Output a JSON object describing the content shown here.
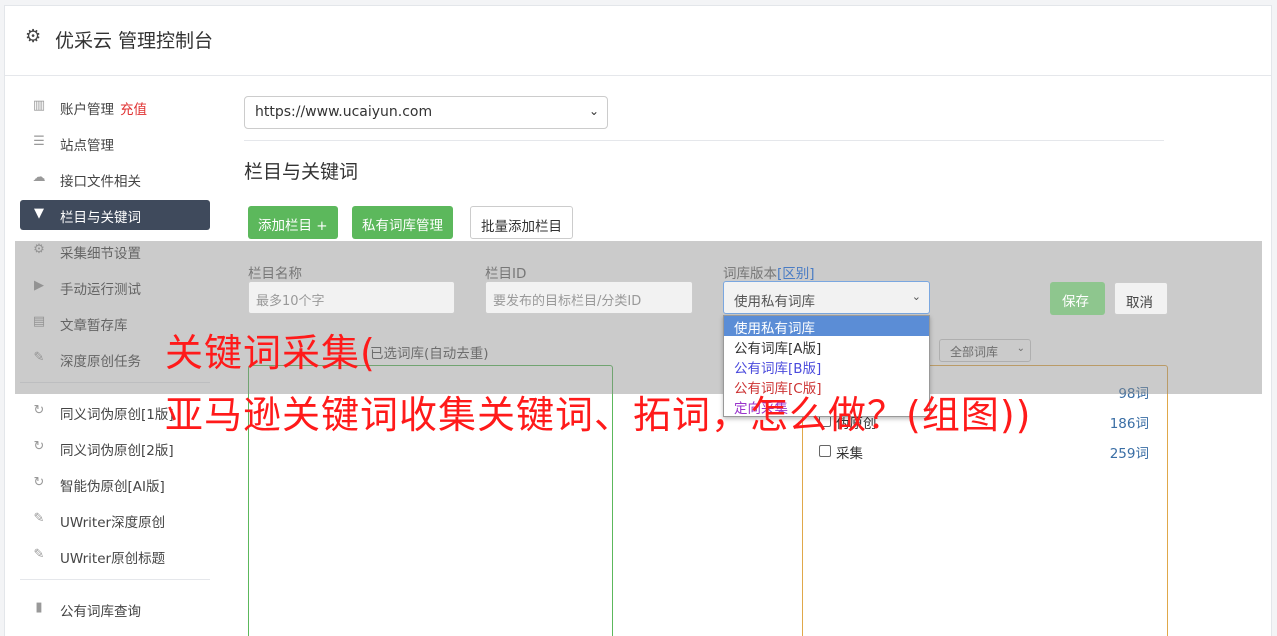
{
  "header": {
    "title": "优采云 管理控制台",
    "icon": "gear-icon"
  },
  "sidebar": {
    "items": [
      {
        "label": "账户管理",
        "icon": "bar-chart-icon",
        "extra": "充值"
      },
      {
        "label": "站点管理",
        "icon": "server-icon"
      },
      {
        "label": "接口文件相关",
        "icon": "cloud-upload-icon"
      },
      {
        "label": "栏目与关键词",
        "icon": "filter-icon",
        "active": true
      },
      {
        "label": "采集细节设置",
        "icon": "gears-icon"
      },
      {
        "label": "手动运行测试",
        "icon": "play-circle-icon"
      },
      {
        "label": "文章暂存库",
        "icon": "database-icon"
      },
      {
        "label": "深度原创任务",
        "icon": "edit-icon"
      }
    ],
    "items2": [
      {
        "label": "同义词伪原创[1版]",
        "icon": "refresh-icon"
      },
      {
        "label": "同义词伪原创[2版]",
        "icon": "refresh-icon"
      },
      {
        "label": "智能伪原创[AI版]",
        "icon": "refresh-icon"
      },
      {
        "label": "UWriter深度原创",
        "icon": "edit-icon"
      },
      {
        "label": "UWriter原创标题",
        "icon": "edit-icon"
      }
    ],
    "items3": [
      {
        "label": "公有词库查询",
        "icon": "book-icon"
      }
    ]
  },
  "site_select": {
    "value": "https://www.ucaiyun.com"
  },
  "section": {
    "title": "栏目与关键词"
  },
  "buttons": {
    "add_column": "添加栏目 +",
    "private_lib": "私有词库管理",
    "batch_add": "批量添加栏目"
  },
  "form": {
    "name_label": "栏目名称",
    "name_placeholder": "最多10个字",
    "id_label": "栏目ID",
    "id_placeholder": "要发布的目标栏目/分类ID",
    "version_label": "词库版本",
    "version_link": "[区别]",
    "version_value": "使用私有词库",
    "save": "保存",
    "cancel": "取消"
  },
  "dropdown": {
    "options": [
      "使用私有词库",
      "公有词库[A版]",
      "公有词库[B版]",
      "公有词库[C版]",
      "定向采集"
    ]
  },
  "selected_lib": {
    "label": "已选词库(自动去重)"
  },
  "lib_filter": {
    "value": "全部词库"
  },
  "libraries": [
    {
      "name": "",
      "count": "98词"
    },
    {
      "name": "伪原创",
      "count": "186词"
    },
    {
      "name": "采集",
      "count": "259词"
    }
  ],
  "watermark": {
    "line1": "关键词采集(",
    "line2": "亚马逊关键词收集关键词、拓词，怎么做？(组图))"
  },
  "colors": {
    "accent_green": "#5cb85c",
    "sidebar_active": "#3f4a5c",
    "watermark": "#ff1a1a"
  }
}
